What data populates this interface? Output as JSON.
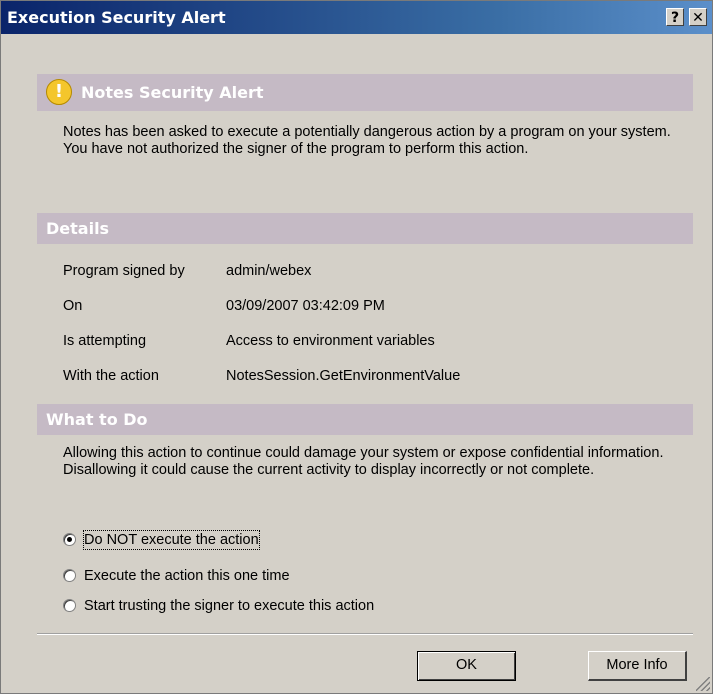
{
  "window": {
    "title": "Execution Security Alert",
    "help_glyph": "?",
    "close_glyph": "✕"
  },
  "alert": {
    "icon_glyph": "!",
    "header": "Notes Security Alert",
    "message": "Notes has been asked to execute a potentially dangerous action by a program on your system.  You have not authorized the signer of the program to perform this action."
  },
  "details": {
    "header": "Details",
    "rows": [
      {
        "key": "Program signed by",
        "value": "admin/webex"
      },
      {
        "key": "On",
        "value": "03/09/2007 03:42:09 PM"
      },
      {
        "key": "Is attempting",
        "value": "Access to environment variables"
      },
      {
        "key": "With the action",
        "value": "NotesSession.GetEnvironmentValue"
      }
    ]
  },
  "what_to_do": {
    "header": "What to Do",
    "message": "Allowing this action to continue could damage your system or expose confidential information. Disallowing it could cause the current activity to display incorrectly or not complete.",
    "options": [
      {
        "label": "Do NOT execute the action",
        "selected": true
      },
      {
        "label": "Execute the action this one time",
        "selected": false
      },
      {
        "label": "Start trusting the signer to execute this action",
        "selected": false
      }
    ]
  },
  "buttons": {
    "ok": "OK",
    "more_info": "More Info"
  },
  "colors": {
    "titlebar_start": "#0a246a",
    "section_header_bg": "#c5bac5",
    "dialog_bg": "#d4d0c8",
    "warning_icon": "#f4c62c"
  }
}
